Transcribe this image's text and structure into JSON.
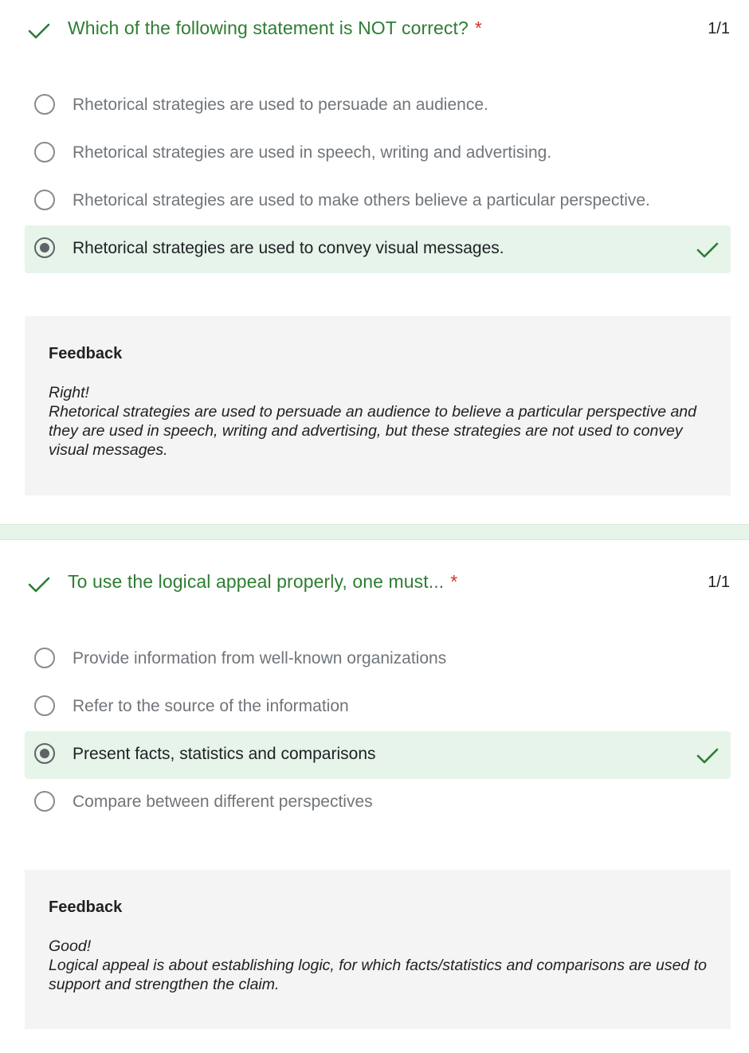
{
  "questions": [
    {
      "title": "Which of the following statement is NOT correct?",
      "required_marker": "*",
      "score": "1/1",
      "options": [
        {
          "label": "Rhetorical strategies are used to persuade an audience.",
          "selected": false
        },
        {
          "label": "Rhetorical strategies are used in speech, writing and advertising.",
          "selected": false
        },
        {
          "label": "Rhetorical strategies are used to make others believe a particular perspective.",
          "selected": false
        },
        {
          "label": "Rhetorical strategies are used to convey visual messages.",
          "selected": true,
          "correct": true
        }
      ],
      "feedback": {
        "heading": "Feedback",
        "lead": "Right!",
        "text": "Rhetorical strategies are used to persuade an audience to believe a particular perspective and they are used in speech, writing and advertising, but these strategies are not used to convey visual messages."
      }
    },
    {
      "title": "To use the logical appeal properly, one must...",
      "required_marker": "*",
      "score": "1/1",
      "options": [
        {
          "label": "Provide information from well-known organizations",
          "selected": false
        },
        {
          "label": "Refer to the source of the information",
          "selected": false
        },
        {
          "label": "Present facts, statistics and comparisons",
          "selected": true,
          "correct": true
        },
        {
          "label": "Compare between different perspectives",
          "selected": false
        }
      ],
      "feedback": {
        "heading": "Feedback",
        "lead": "Good!",
        "text": "Logical appeal is about establishing logic, for which facts/statistics and comparisons are used to support and strengthen the claim."
      }
    }
  ],
  "icons": {
    "correct_check": "check-icon"
  },
  "colors": {
    "correct_green": "#2e7d32",
    "selected_bg": "#e6f4ea",
    "required_red": "#d93025",
    "feedback_bg": "#f4f4f4"
  }
}
